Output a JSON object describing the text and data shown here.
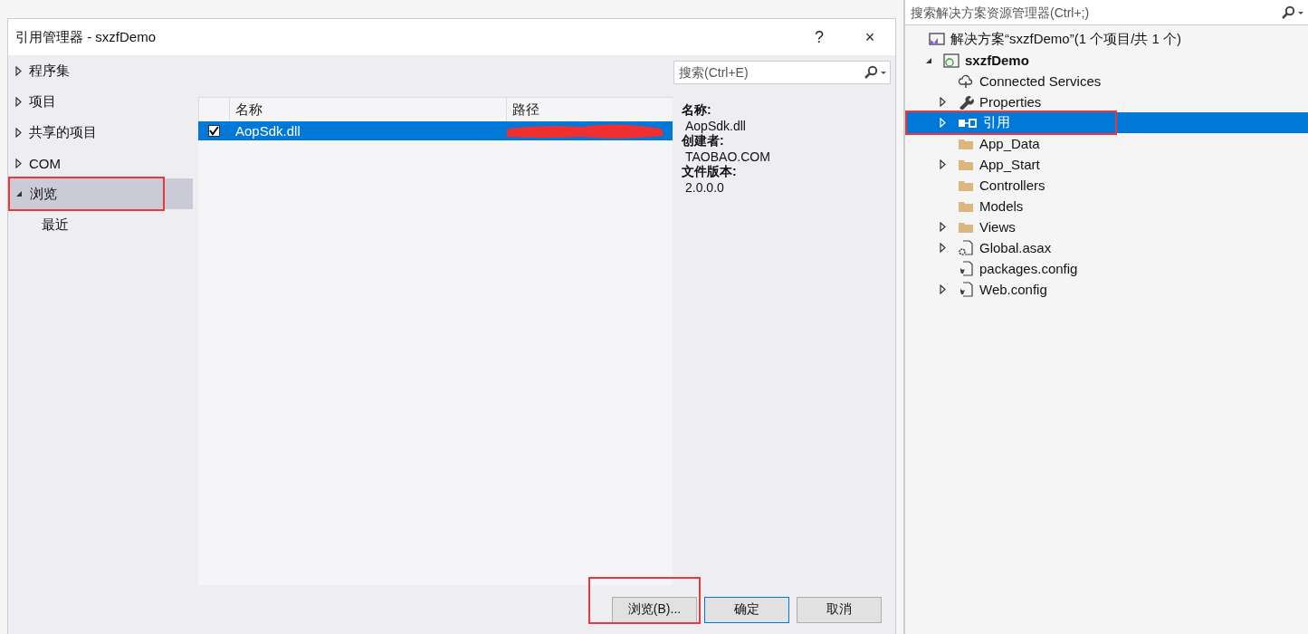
{
  "dialog": {
    "title": "引用管理器 - sxzfDemo",
    "help": "?",
    "close": "×",
    "nav": [
      {
        "label": "程序集",
        "kind": "collapsed",
        "selected": false,
        "annotated": false
      },
      {
        "label": "项目",
        "kind": "collapsed",
        "selected": false,
        "annotated": false
      },
      {
        "label": "共享的项目",
        "kind": "collapsed",
        "selected": false,
        "annotated": false
      },
      {
        "label": "COM",
        "kind": "collapsed",
        "selected": false,
        "annotated": false
      },
      {
        "label": "浏览",
        "kind": "expanded",
        "selected": true,
        "annotated": true
      },
      {
        "label": "最近",
        "kind": "leaf",
        "selected": false,
        "annotated": false
      }
    ],
    "search": {
      "placeholder": "搜索(Ctrl+E)"
    },
    "table": {
      "columns": [
        "名称",
        "路径"
      ],
      "rows": [
        {
          "checked": true,
          "selected": true,
          "name": "AopSdk.dll",
          "path_redacted": true
        }
      ]
    },
    "details": [
      {
        "label": "名称:",
        "value": "AopSdk.dll"
      },
      {
        "label": "创建者:",
        "value": "TAOBAO.COM"
      },
      {
        "label": "文件版本:",
        "value": "2.0.0.0"
      }
    ],
    "buttons": [
      {
        "label": "浏览(B)...",
        "kind": "normal",
        "annotated": true
      },
      {
        "label": "确定",
        "kind": "default",
        "annotated": false
      },
      {
        "label": "取消",
        "kind": "normal",
        "annotated": false
      }
    ]
  },
  "solution_explorer": {
    "search": {
      "placeholder": "搜索解决方案资源管理器(Ctrl+;)"
    },
    "tree": [
      {
        "label": "解决方案“sxzfDemo”(1 个项目/共 1 个)",
        "kind": "solution",
        "selected": false,
        "annotated": false,
        "bold": false,
        "children": [
          {
            "label": "sxzfDemo",
            "kind": "web-project",
            "expanded": true,
            "selected": false,
            "annotated": false,
            "bold": true,
            "children": [
              {
                "label": "Connected Services",
                "kind": "cloud",
                "selected": false,
                "annotated": false,
                "bold": false
              },
              {
                "label": "Properties",
                "kind": "wrench",
                "expanded": false,
                "selected": false,
                "annotated": false,
                "bold": false
              },
              {
                "label": "引用",
                "kind": "reference",
                "expanded": false,
                "selected": true,
                "annotated": true,
                "bold": false
              },
              {
                "label": "App_Data",
                "kind": "folder",
                "selected": false,
                "annotated": false,
                "bold": false
              },
              {
                "label": "App_Start",
                "kind": "folder",
                "expanded": false,
                "selected": false,
                "annotated": false,
                "bold": false
              },
              {
                "label": "Controllers",
                "kind": "folder",
                "selected": false,
                "annotated": false,
                "bold": false
              },
              {
                "label": "Models",
                "kind": "folder",
                "selected": false,
                "annotated": false,
                "bold": false
              },
              {
                "label": "Views",
                "kind": "folder",
                "expanded": false,
                "selected": false,
                "annotated": false,
                "bold": false
              },
              {
                "label": "Global.asax",
                "kind": "gear-file",
                "expanded": false,
                "selected": false,
                "annotated": false,
                "bold": false
              },
              {
                "label": "packages.config",
                "kind": "config-file",
                "selected": false,
                "annotated": false,
                "bold": false
              },
              {
                "label": "Web.config",
                "kind": "config-file",
                "expanded": false,
                "selected": false,
                "annotated": false,
                "bold": false
              }
            ]
          }
        ]
      }
    ]
  }
}
